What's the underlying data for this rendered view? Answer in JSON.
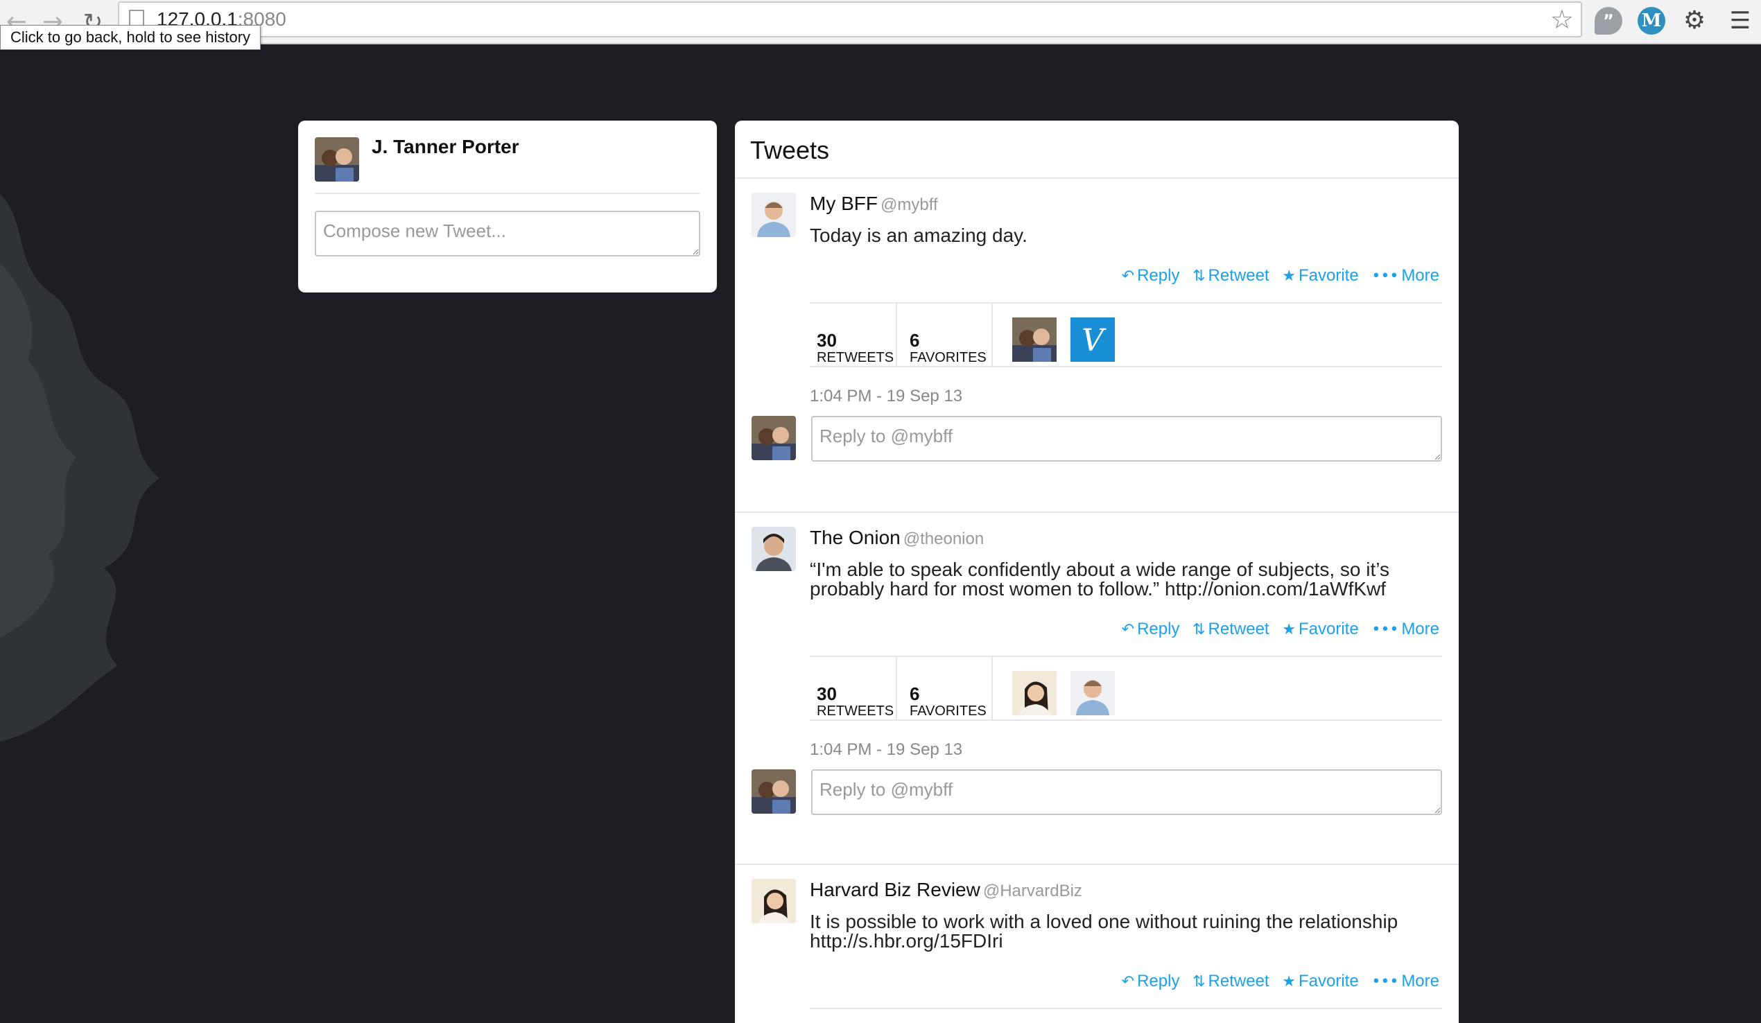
{
  "browser": {
    "url_host": "127.0.0.1",
    "url_port": ":8080",
    "tooltip": "Click to go back, hold to see history"
  },
  "profile": {
    "name": "J. Tanner Porter",
    "compose_placeholder": "Compose new Tweet..."
  },
  "tweets_header": "Tweets",
  "actions": {
    "reply": "Reply",
    "retweet": "Retweet",
    "favorite": "Favorite",
    "more": "More"
  },
  "tweets": [
    {
      "name": "My BFF",
      "handle": "@mybff",
      "text": "Today is an amazing day.",
      "retweets": "30",
      "retweets_label": "RETWEETS",
      "favorites": "6",
      "favorites_label": "FAVORITES",
      "timestamp": "1:04 PM - 19 Sep 13",
      "reply_placeholder": "Reply to @mybff"
    },
    {
      "name": "The Onion",
      "handle": "@theonion",
      "text": "“I'm able to speak confidently about a wide range of subjects, so it’s probably hard for most women to follow.” http://onion.com/1aWfKwf",
      "retweets": "30",
      "retweets_label": "RETWEETS",
      "favorites": "6",
      "favorites_label": "FAVORITES",
      "timestamp": "1:04 PM - 19 Sep 13",
      "reply_placeholder": "Reply to @mybff"
    },
    {
      "name": "Harvard Biz Review",
      "handle": "@HarvardBiz",
      "text": "It is possible to work with a loved one without ruining the relationship http://s.hbr.org/15FDIri"
    }
  ],
  "colors": {
    "link": "#1da1e8",
    "background": "#1c1e23"
  }
}
